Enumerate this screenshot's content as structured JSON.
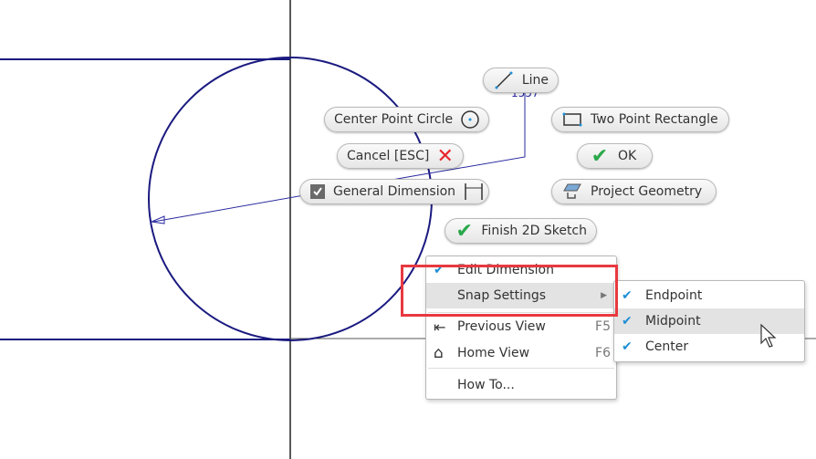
{
  "sketch": {
    "dimension_value": "1557"
  },
  "marking_menu": {
    "line": "Line",
    "center_point_circle": "Center Point Circle",
    "cancel": "Cancel [ESC]",
    "general_dimension": "General Dimension",
    "two_point_rectangle": "Two Point Rectangle",
    "ok": "OK",
    "project_geometry": "Project Geometry",
    "finish_sketch": "Finish 2D Sketch"
  },
  "context_menu": {
    "items": [
      {
        "label": "Edit Dimension",
        "checked": true
      },
      {
        "label": "Snap Settings",
        "has_submenu": true,
        "highlighted": true
      },
      {
        "label": "Previous View",
        "shortcut": "F5",
        "icon": "previous-view-icon"
      },
      {
        "label": "Home View",
        "shortcut": "F6",
        "icon": "home-icon"
      },
      {
        "label": "How To..."
      }
    ]
  },
  "snap_submenu": {
    "items": [
      {
        "label": "Endpoint",
        "checked": true
      },
      {
        "label": "Midpoint",
        "checked": true,
        "highlighted": true
      },
      {
        "label": "Center",
        "checked": true
      }
    ]
  },
  "colors": {
    "sketch": "#1a1a80",
    "highlight_box": "#e8393f",
    "check": "#1e8fd6",
    "ok_green": "#2aa84a",
    "cancel_red": "#e8262c"
  }
}
